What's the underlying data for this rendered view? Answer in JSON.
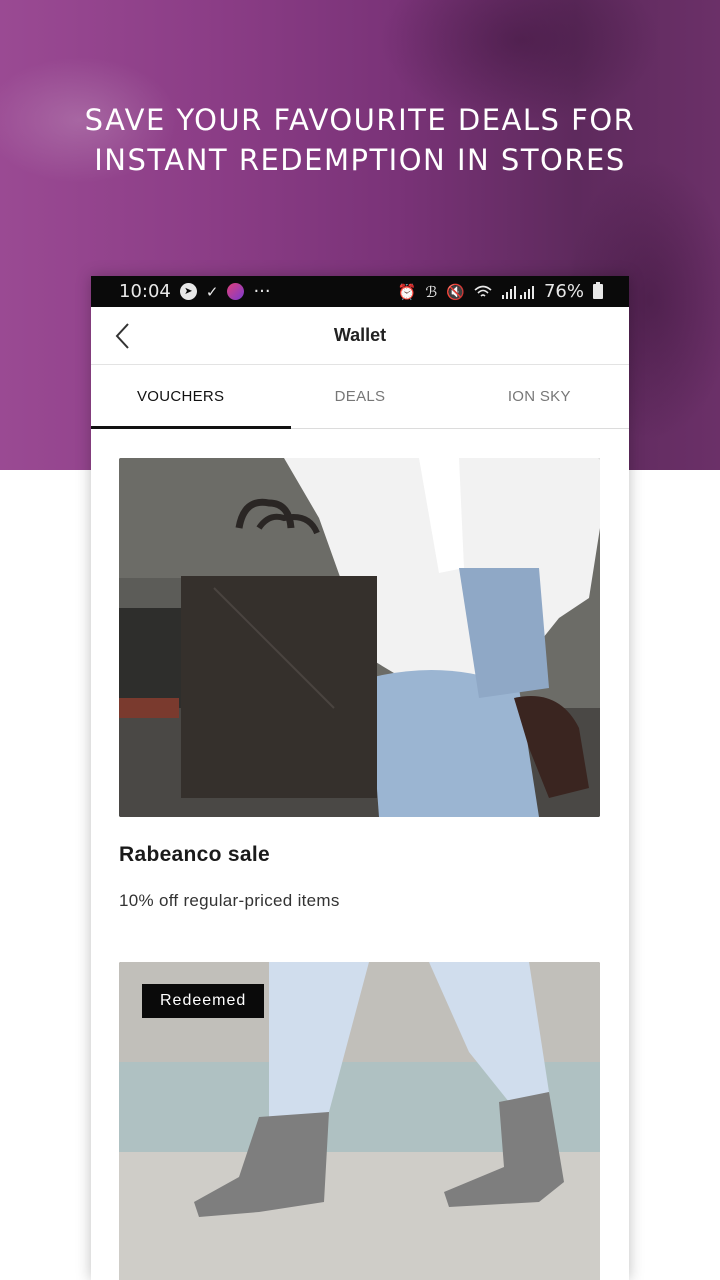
{
  "hero": {
    "title": "SAVE YOUR FAVOURITE DEALS FOR INSTANT REDEMPTION IN STORES"
  },
  "status_bar": {
    "time": "10:04",
    "more": "···",
    "battery": "76%"
  },
  "header": {
    "title": "Wallet"
  },
  "tabs": [
    {
      "label": "VOUCHERS",
      "active": true
    },
    {
      "label": "DEALS",
      "active": false
    },
    {
      "label": "ION SKY",
      "active": false
    }
  ],
  "vouchers": [
    {
      "title": "Rabeanco sale",
      "subtitle": "10% off regular-priced items",
      "badge": ""
    },
    {
      "title": "",
      "subtitle": "",
      "badge": "Redeemed"
    }
  ],
  "colors": {
    "hero_purple": "#8b3d86",
    "tab_indicator": "#111111",
    "badge_bg": "#0a0a0a"
  }
}
